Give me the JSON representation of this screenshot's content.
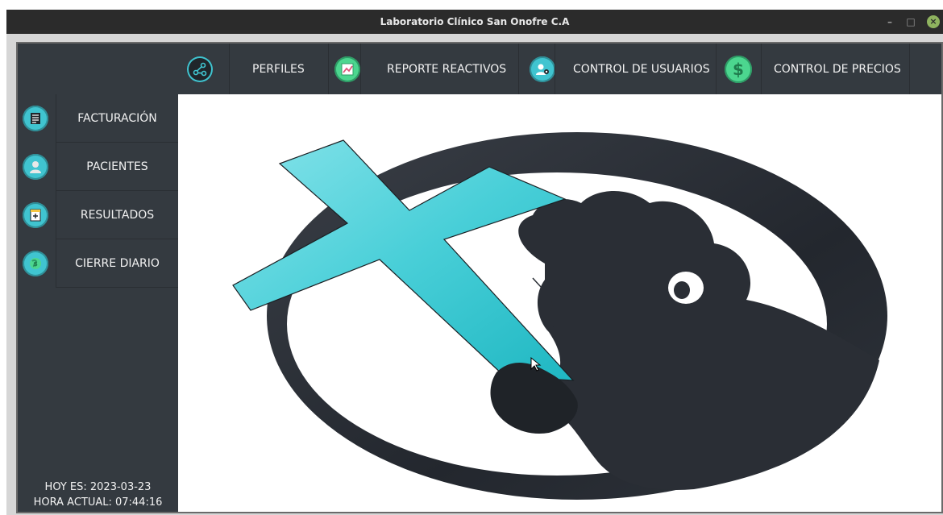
{
  "window": {
    "title": "Laboratorio Clínico San Onofre C.A",
    "minimize": "–",
    "maximize": "□",
    "close": "×"
  },
  "topnav": {
    "items": [
      {
        "label": "PERFILES",
        "icon": "share-nodes-icon"
      },
      {
        "label": "REPORTE REACTIVOS",
        "icon": "chart-report-icon"
      },
      {
        "label": "CONTROL DE USUARIOS",
        "icon": "user-settings-icon"
      },
      {
        "label": "CONTROL DE PRECIOS",
        "icon": "dollar-icon"
      }
    ]
  },
  "sidebar": {
    "items": [
      {
        "label": "FACTURACIÓN",
        "icon": "invoice-icon"
      },
      {
        "label": "PACIENTES",
        "icon": "patient-icon"
      },
      {
        "label": "RESULTADOS",
        "icon": "results-icon"
      },
      {
        "label": "CIERRE DIARIO",
        "icon": "daily-close-icon"
      }
    ],
    "date_line": "HOY ES: 2023-03-23",
    "time_line": "HORA ACTUAL: 07:44:16"
  },
  "colors": {
    "panel": "#343a40",
    "accent_cyan": "#40c4d0",
    "accent_green": "#4cd68f",
    "logo_dark": "#2a2e35",
    "logo_cross": "#49cfd8"
  },
  "icons": {
    "cursor": "mouse-pointer-icon",
    "logo": "clinic-logo"
  }
}
